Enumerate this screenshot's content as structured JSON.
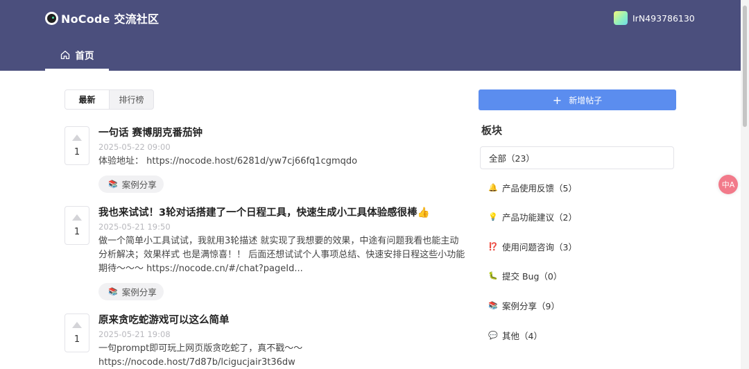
{
  "header": {
    "title": "NoCode 交流社区",
    "user_name": "IrN493786130",
    "nav_home": "首页"
  },
  "sort_tabs": [
    "最新",
    "排行榜"
  ],
  "posts": [
    {
      "votes": "1",
      "title": "一句话 赛博朋克番茄钟",
      "date": "2025-05-22 09:00",
      "content": "体验地址： https://nocode.host/6281d/yw7cj66fq1cgmqdo",
      "tag": "案例分享"
    },
    {
      "votes": "1",
      "title": "我也来试试！3轮对话搭建了一个日程工具，快速生成小工具体验感很棒👍",
      "date": "2025-05-21 19:50",
      "content": "做一个简单小工具试试，我就用3轮描述 就实现了我想要的效果，中途有问题我看也能主动分析解决；效果样式 也是满惊喜！！ 后面还想试试个人事项总结、快速安排日程这些小功能 期待～～～ https://nocode.cn/#/chat?pageId...",
      "tag": "案例分享"
    },
    {
      "votes": "1",
      "title": "原来贪吃蛇游戏可以这么简单",
      "date": "2025-05-21 19:08",
      "content": "一句prompt即可玩上网页版贪吃蛇了，真不戳～～ https://nocode.host/7d87b/lcigucjair3t36dw"
    }
  ],
  "sidebar": {
    "new_post_label": "新增帖子",
    "section_title": "板块",
    "categories": [
      {
        "icon": "",
        "label": "全部（23）"
      },
      {
        "icon": "🔔",
        "label": "产品使用反馈（5）"
      },
      {
        "icon": "💡",
        "label": "产品功能建议（2）"
      },
      {
        "icon": "⁉️",
        "label": "使用问题咨询（3）"
      },
      {
        "icon": "🐛",
        "label": "提交 Bug（0）"
      },
      {
        "icon": "📚",
        "label": "案例分享（9）"
      },
      {
        "icon": "💬",
        "label": "其他（4）"
      }
    ]
  },
  "tag_icon": "📚",
  "translate_label": "中A"
}
